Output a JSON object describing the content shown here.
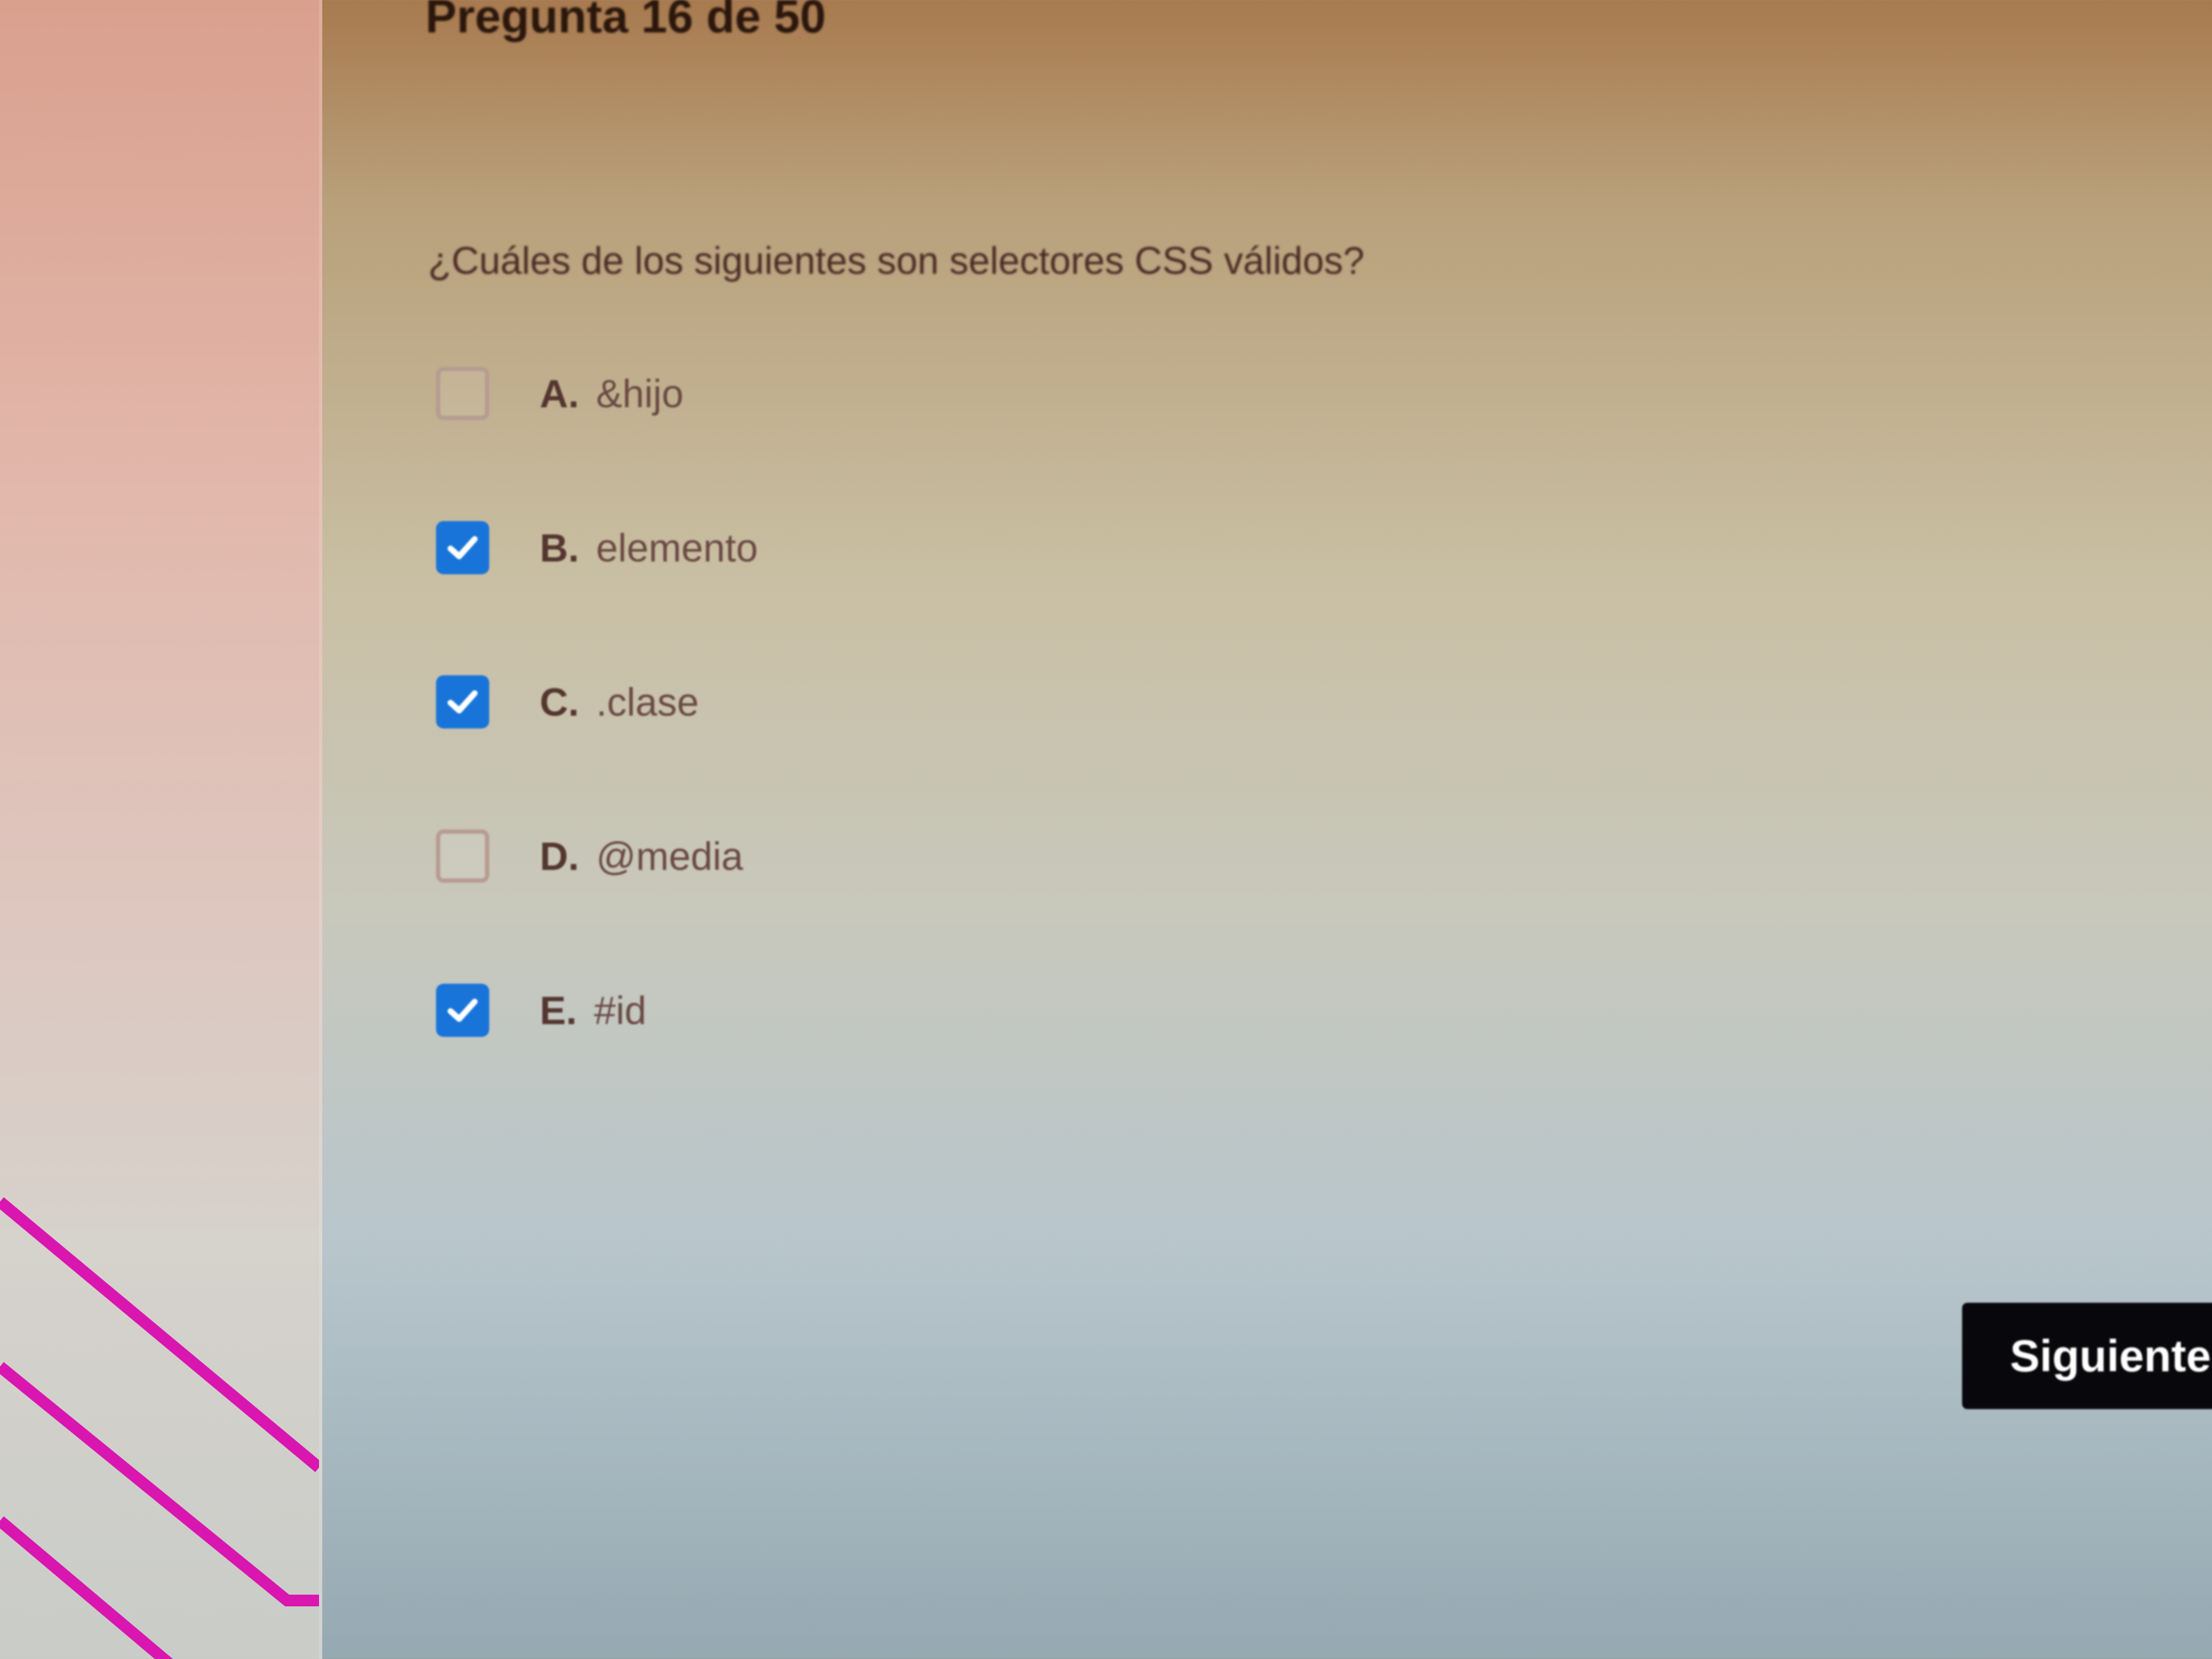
{
  "header": {
    "question_counter": "Pregunta 16 de 50"
  },
  "question": {
    "text": "¿Cuáles de los siguientes son selectores CSS válidos?",
    "options": [
      {
        "letter": "A.",
        "text": "&hijo",
        "checked": false
      },
      {
        "letter": "B.",
        "text": "elemento",
        "checked": true
      },
      {
        "letter": "C.",
        "text": ".clase",
        "checked": true
      },
      {
        "letter": "D.",
        "text": "@media",
        "checked": false
      },
      {
        "letter": "E.",
        "text": "#id",
        "checked": true
      }
    ]
  },
  "actions": {
    "next_label": "Siguiente"
  },
  "colors": {
    "checkbox_checked": "#1874d8",
    "decorative_lines": "#d916b0",
    "button_bg": "#08080c"
  },
  "icons": {
    "checkmark": "check-icon",
    "decoration": "diagonal-lines"
  }
}
